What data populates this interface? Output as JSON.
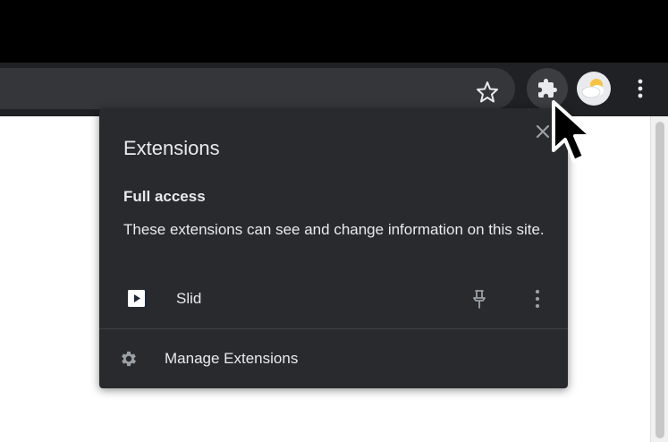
{
  "toolbar": {
    "bookmark_icon": "star-outline-icon",
    "extensions_icon": "puzzle-piece-icon",
    "profile_icon": "weather-avatar-icon",
    "menu_icon": "vertical-dots-icon"
  },
  "extensions_menu": {
    "title": "Extensions",
    "close_icon": "close-icon",
    "section": {
      "title": "Full access",
      "description": "These extensions can see and change information on this site."
    },
    "items": [
      {
        "name": "Slid",
        "icon": "slid-logo-icon",
        "pin_icon": "pin-icon",
        "menu_icon": "vertical-dots-icon"
      }
    ],
    "manage": {
      "label": "Manage Extensions",
      "icon": "gear-icon"
    }
  },
  "colors": {
    "titlebar": "#000000",
    "toolbar": "#202124",
    "omnibox": "#35363a",
    "popup_bg": "#292a2d",
    "popup_text": "#e8eaed",
    "icon_gray": "#9aa0a6"
  }
}
